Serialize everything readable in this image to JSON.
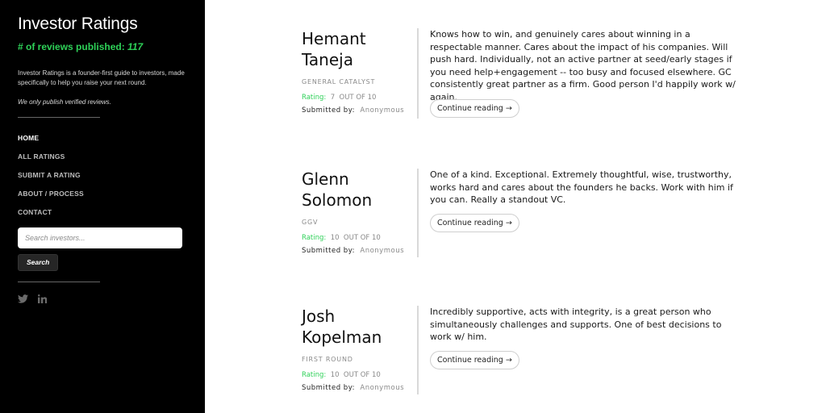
{
  "sidebar": {
    "title": "Investor Ratings",
    "count_label": "# of reviews published:",
    "count_value": "117",
    "intro": "Investor Ratings is a founder-first guide to investors, made specifically to help you raise your next round.",
    "verified": "We only publish verified reviews.",
    "nav": [
      {
        "label": "HOME",
        "active": true
      },
      {
        "label": "ALL RATINGS",
        "active": false
      },
      {
        "label": "SUBMIT A RATING",
        "active": false
      },
      {
        "label": "ABOUT / PROCESS",
        "active": false
      },
      {
        "label": "CONTACT",
        "active": false
      }
    ],
    "search": {
      "placeholder": "Search investors...",
      "button_label": "Search"
    },
    "social": [
      {
        "icon": "twitter-icon"
      },
      {
        "icon": "linkedin-icon"
      }
    ]
  },
  "entries": [
    {
      "name_line1": "Hemant",
      "name_line2": "Taneja",
      "firm": "GENERAL CATALYST",
      "rating_label": "Rating:",
      "rating_value": "7",
      "rating_out_of": "OUT OF 10",
      "submitted_label": "Submitted by:",
      "submitted_by": "Anonymous",
      "review": "Knows how to win, and genuinely cares about winning in a respectable manner. Cares about the impact of his companies. Will push hard. Individually, not an active partner at seed/early stages if you need help+engagement -- too busy and focused elsewhere. GC consistently great partner as a firm. Good person I'd happily work w/ again.",
      "continue_label": "Continue reading →"
    },
    {
      "name_line1": "Glenn",
      "name_line2": "Solomon",
      "firm": "GGV",
      "rating_label": "Rating:",
      "rating_value": "10",
      "rating_out_of": "OUT OF 10",
      "submitted_label": "Submitted by:",
      "submitted_by": "Anonymous",
      "review": "One of a kind. Exceptional. Extremely thoughtful, wise, trustworthy, works hard and cares about the founders he backs. Work with him if you can. Really a standout VC.",
      "continue_label": "Continue reading →"
    },
    {
      "name_line1": "Josh",
      "name_line2": "Kopelman",
      "firm": "FIRST ROUND",
      "rating_label": "Rating:",
      "rating_value": "10",
      "rating_out_of": "OUT OF 10",
      "submitted_label": "Submitted by:",
      "submitted_by": "Anonymous",
      "review": "Incredibly supportive, acts with integrity, is a great person who simultaneously challenges and supports. One of best decisions to work w/ him.",
      "continue_label": "Continue reading →"
    }
  ],
  "colors": {
    "accent": "#2ed158",
    "sidebar_bg": "#000000",
    "page_bg": "#ffffff"
  }
}
